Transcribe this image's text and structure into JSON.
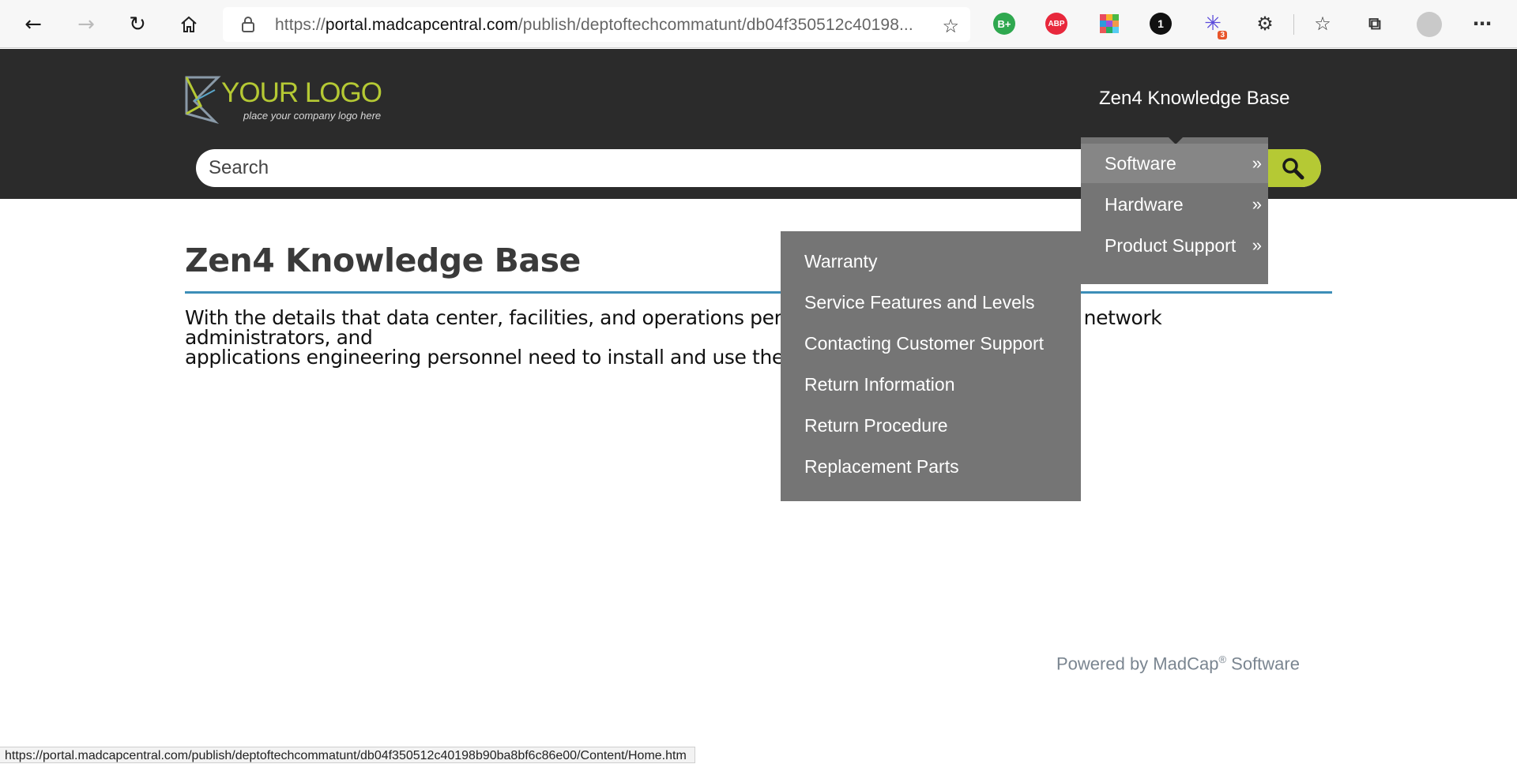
{
  "browser": {
    "url_scheme": "https://",
    "url_host": "portal.madcapcentral.com",
    "url_path": "/publish/deptoftechcommatunt/db04f350512c40198...",
    "extensions": {
      "bplus_label": "B+",
      "abp_label": "ABP",
      "onepass_label": "1",
      "star_badge": "3"
    },
    "status_url": "https://portal.madcapcentral.com/publish/deptoftechcommatunt/db04f350512c40198b90ba8bf6c86e00/Content/Home.htm"
  },
  "header": {
    "logo_text": "YOUR LOGO",
    "logo_tagline": "place your company logo here",
    "site_title": "Zen4 Knowledge Base",
    "search_placeholder": "Search"
  },
  "nav_menu": [
    {
      "label": "Software",
      "arrow": "»"
    },
    {
      "label": "Hardware",
      "arrow": "»"
    },
    {
      "label": "Product Support",
      "arrow": "»"
    }
  ],
  "submenu": [
    {
      "label": "Warranty"
    },
    {
      "label": "Service Features and Levels"
    },
    {
      "label": "Contacting Customer Support"
    },
    {
      "label": "Return Information"
    },
    {
      "label": "Return Procedure"
    },
    {
      "label": "Replacement Parts"
    }
  ],
  "content": {
    "title": "Zen4 Knowledge Base",
    "intro_line1": "With the details that data center, facilities, and operations personnel, system administrators, network administrators, and",
    "intro_line2": "applications engineering personnel need to install and use the Zen4 enterprise server."
  },
  "footer": {
    "powered_prefix": "Powered by MadCap",
    "powered_reg": "®",
    "powered_suffix": " Software"
  },
  "colors": {
    "header_bg": "#2b2b2b",
    "accent_green": "#b5c934",
    "menu_bg": "#757575",
    "rule_blue": "#3d8eb8"
  }
}
